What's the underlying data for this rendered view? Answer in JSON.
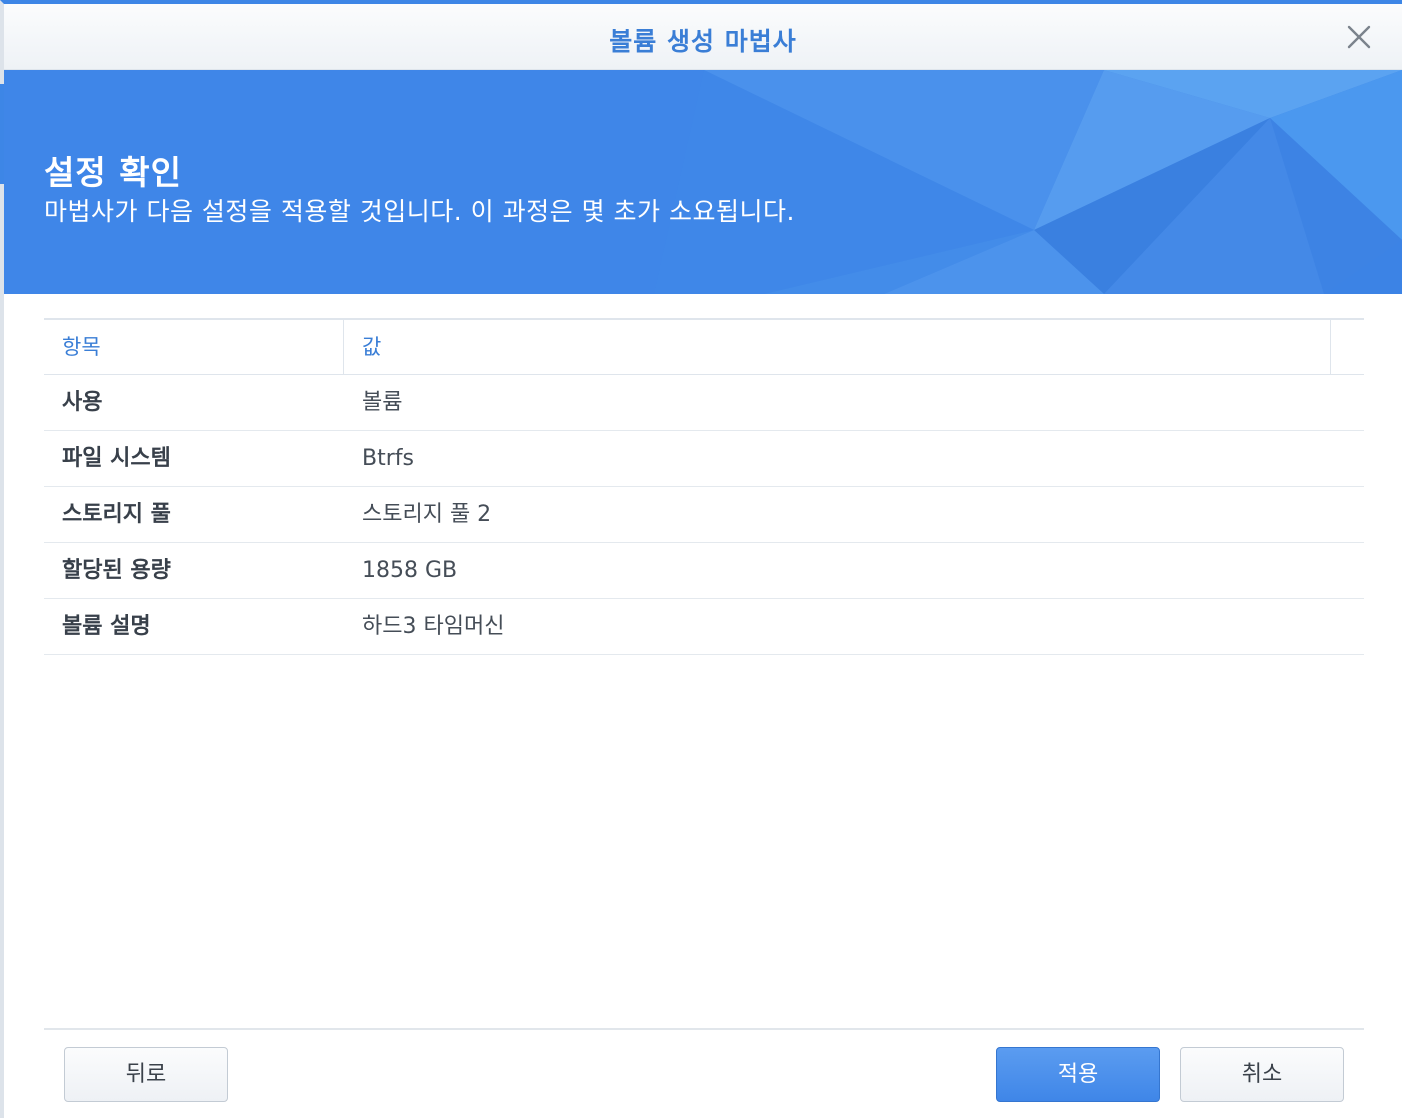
{
  "window": {
    "title": "볼륨 생성 마법사"
  },
  "banner": {
    "title": "설정 확인",
    "subtitle": "마법사가 다음 설정을 적용할 것입니다. 이 과정은 몇 초가 소요됩니다."
  },
  "table": {
    "headers": [
      "항목",
      "값"
    ],
    "rows": [
      {
        "key": "사용",
        "value": "볼륨"
      },
      {
        "key": "파일 시스템",
        "value": "Btrfs"
      },
      {
        "key": "스토리지 풀",
        "value": "스토리지 풀 2"
      },
      {
        "key": "할당된 용량",
        "value": "1858 GB"
      },
      {
        "key": "볼륨 설명",
        "value": "하드3 타임머신"
      }
    ]
  },
  "buttons": {
    "back": "뒤로",
    "apply": "적용",
    "cancel": "취소"
  },
  "icons": {
    "close": "close-icon"
  },
  "colors": {
    "accent": "#3d86e6",
    "banner": "#3f86e8",
    "header_text": "#3a7ed6"
  }
}
